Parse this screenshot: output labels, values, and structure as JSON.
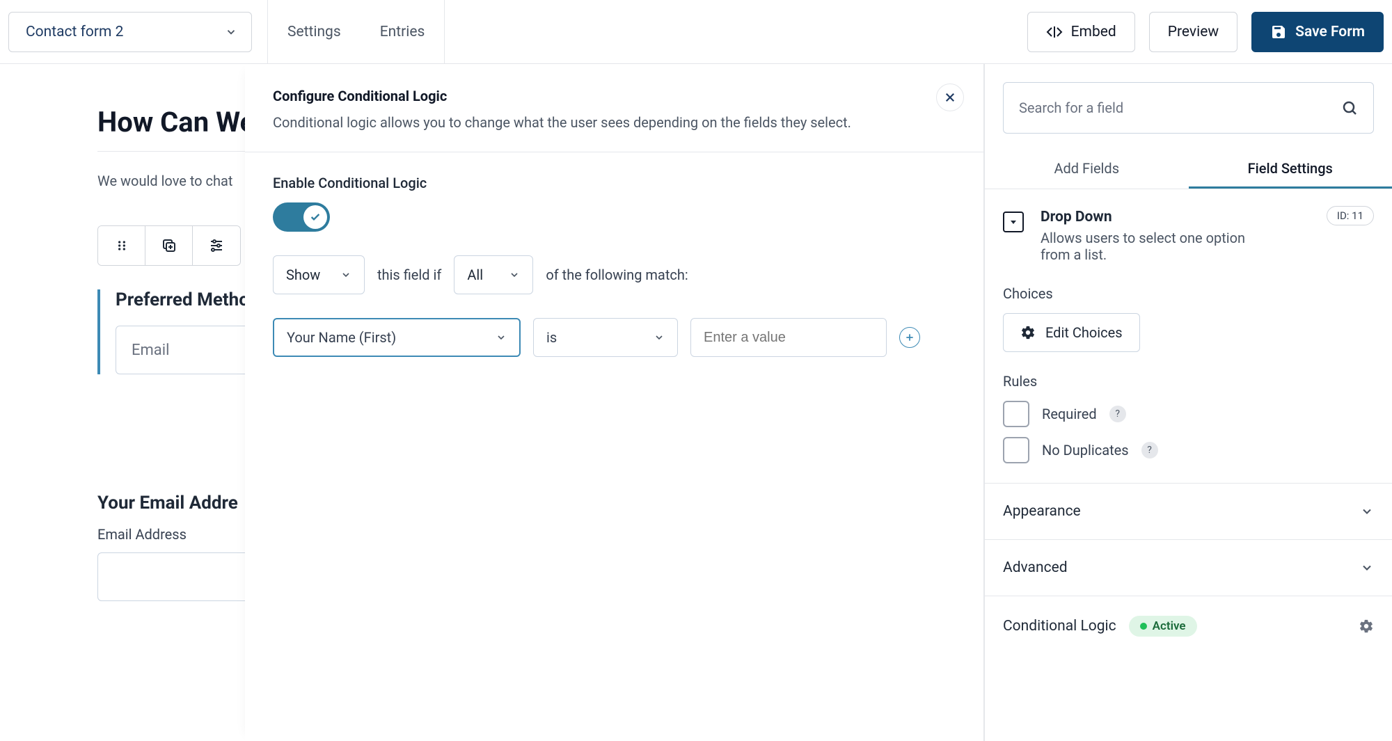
{
  "topbar": {
    "form_name": "Contact form 2",
    "tabs": {
      "settings": "Settings",
      "entries": "Entries"
    },
    "embed": "Embed",
    "preview": "Preview",
    "save": "Save Form"
  },
  "canvas": {
    "title": "How Can We",
    "desc": "We would love to chat",
    "field_label": "Preferred Metho",
    "field_value": "Email",
    "email_section_title": "Your Email Addre",
    "email_field_label": "Email Address"
  },
  "overlay": {
    "title": "Configure Conditional Logic",
    "subtitle": "Conditional logic allows you to change what the user sees depending on the fields they select.",
    "enable_label": "Enable Conditional Logic",
    "show": "Show",
    "text_field_if": "this field if",
    "all": "All",
    "text_match": "of the following match:",
    "rule_field": "Your Name (First)",
    "rule_op": "is",
    "rule_value_placeholder": "Enter a value"
  },
  "sidebar": {
    "search_placeholder": "Search for a field",
    "tab_add": "Add Fields",
    "tab_settings": "Field Settings",
    "field_type": "Drop Down",
    "field_desc": "Allows users to select one option from a list.",
    "id_pill": "ID: 11",
    "choices_label": "Choices",
    "edit_choices": "Edit Choices",
    "rules_label": "Rules",
    "required": "Required",
    "no_duplicates": "No Duplicates",
    "appearance": "Appearance",
    "advanced": "Advanced",
    "conditional_logic": "Conditional Logic",
    "active": "Active"
  }
}
